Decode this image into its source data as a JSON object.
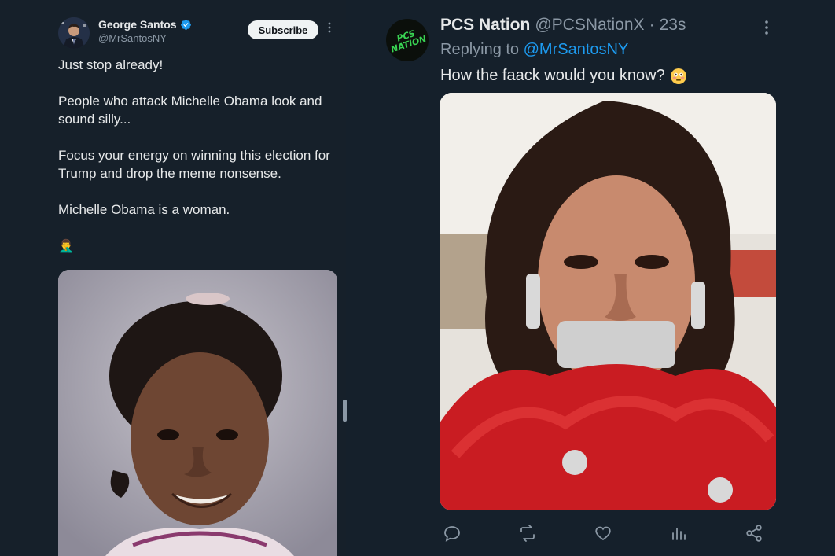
{
  "left_post": {
    "author_name": "George Santos",
    "author_handle": "@MrSantosNY",
    "subscribe_label": "Subscribe",
    "more_icon": "more-vertical-icon",
    "paragraphs": [
      "Just stop already!",
      "People who attack Michelle Obama look and sound silly...",
      "Focus your energy on winning this election for Trump and drop the meme nonsense.",
      "Michelle Obama is a woman."
    ],
    "emoji": "🤦‍♂️"
  },
  "right_post": {
    "avatar_text": "PCS NATION",
    "author_name": "PCS Nation",
    "author_handle": "@PCSNationX",
    "separator": "·",
    "timestamp": "23s",
    "replying_prefix": "Replying to",
    "replying_to": "@MrSantosNY",
    "text": "How the faack would you know?",
    "emoji_icon": "flushed-face-emoji",
    "actions": [
      "reply-icon",
      "repost-icon",
      "like-icon",
      "views-icon",
      "share-icon"
    ]
  },
  "colors": {
    "background": "#15202b",
    "text": "#e7e9ea",
    "muted": "#8b98a5",
    "link": "#1d9bf0",
    "verified": "#1d9bf0"
  }
}
